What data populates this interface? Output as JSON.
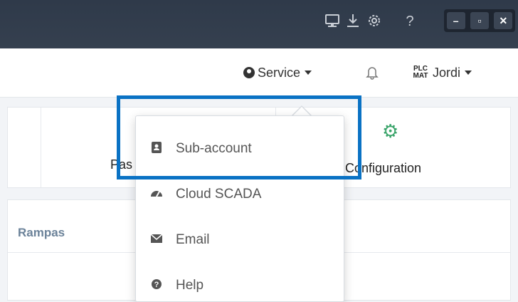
{
  "titlebar": {
    "icons": [
      "monitor-icon",
      "download-icon",
      "settings-icon",
      "help-icon"
    ],
    "help_glyph": "?",
    "controls": {
      "minimize": "–",
      "maximize": "▫",
      "close": "✕"
    }
  },
  "header": {
    "service_label": "Service",
    "user_name": "Jordi",
    "logo_text_top": "PLC",
    "logo_text_bottom": "MAT"
  },
  "cards": {
    "partial_label": "Pas",
    "configuration_label": "Configuration"
  },
  "panel": {
    "tab_label": "Rampas"
  },
  "dropdown": {
    "items": [
      {
        "label": "Sub-account",
        "icon": "contact-book-icon"
      },
      {
        "label": "Cloud SCADA",
        "icon": "dashboard-icon"
      },
      {
        "label": "Email",
        "icon": "envelope-icon"
      },
      {
        "label": "Help",
        "icon": "question-circle-icon"
      }
    ]
  },
  "colors": {
    "titlebar": "#2f3a4a",
    "highlight": "#0a72c4",
    "gear": "#3aa46a",
    "tab_text": "#6b8299"
  }
}
